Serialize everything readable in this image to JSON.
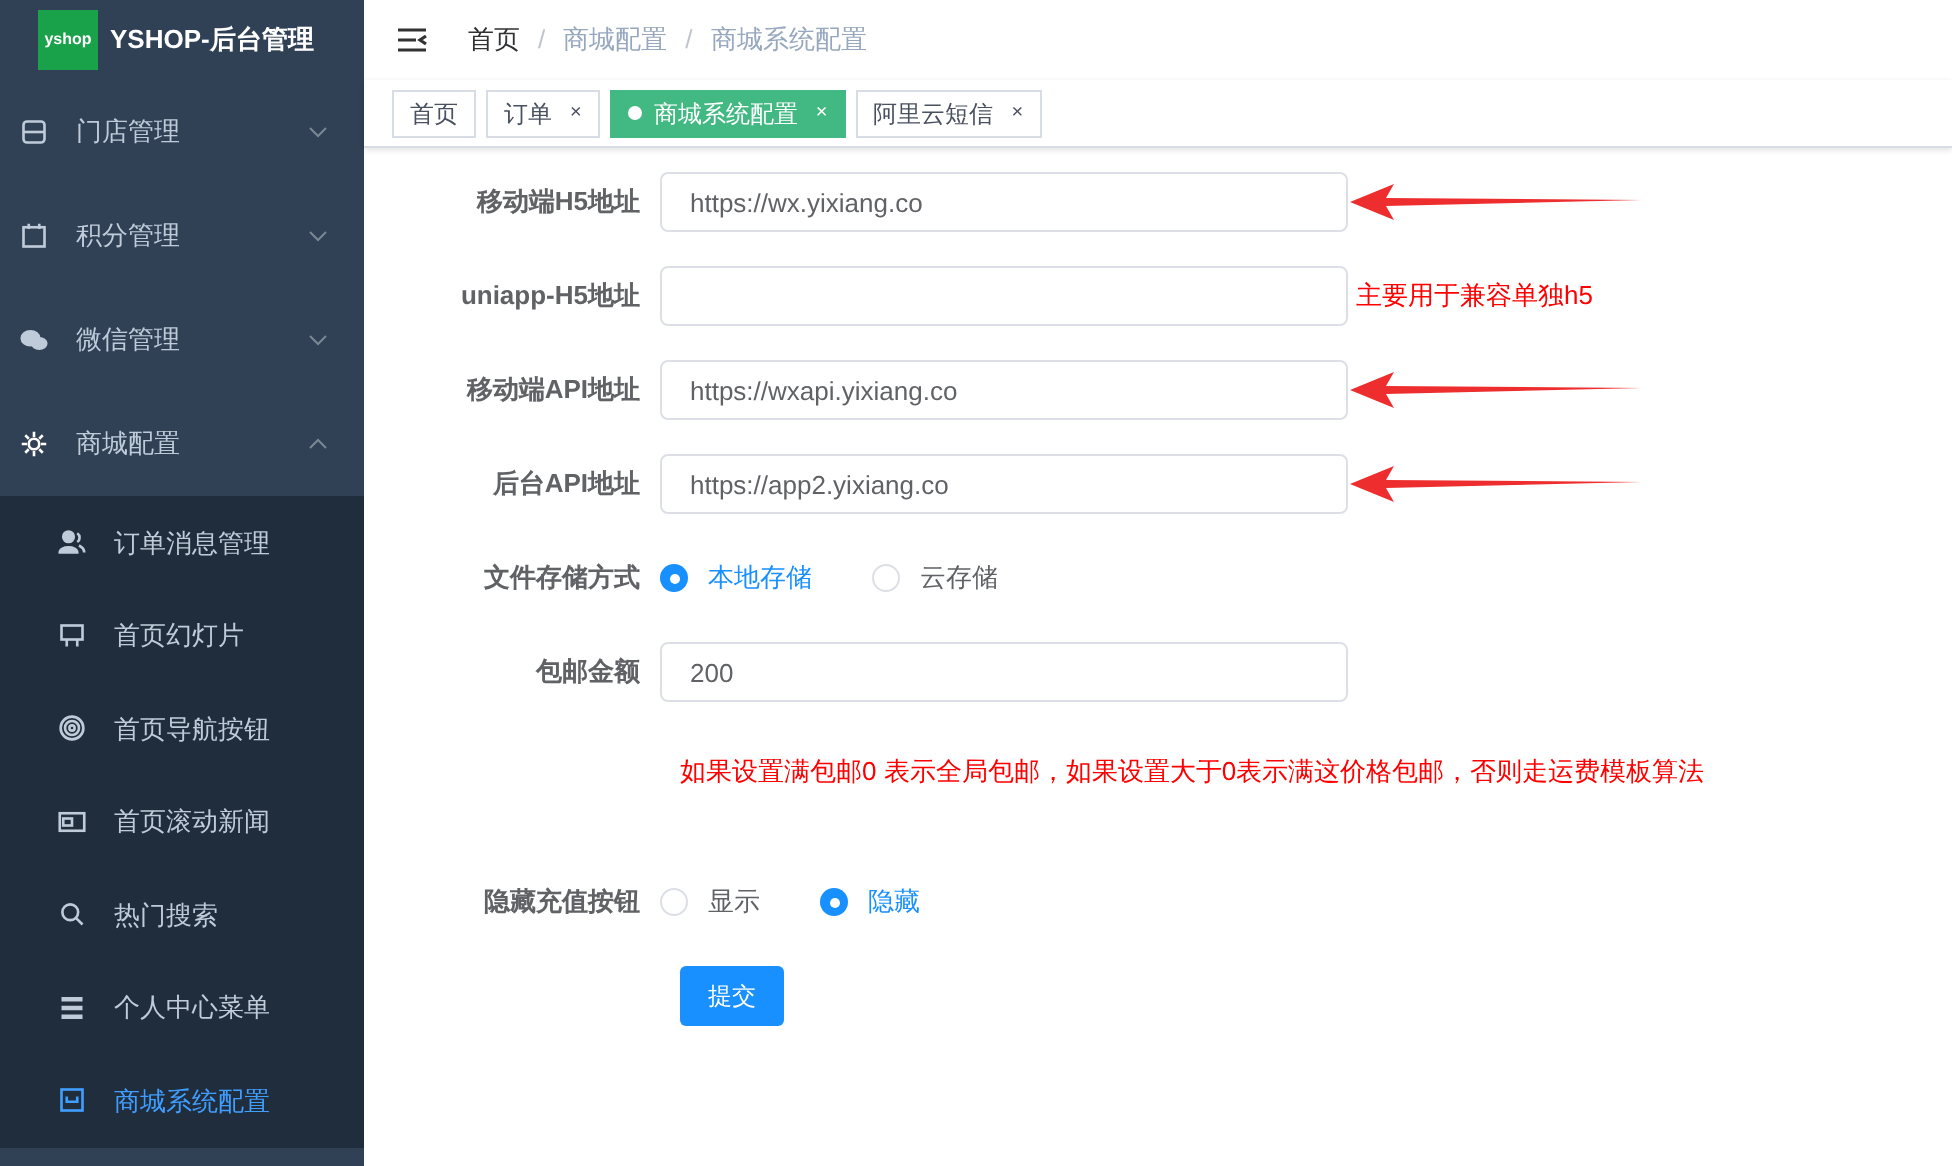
{
  "brand": {
    "title": "YSHOP-后台管理",
    "logo_text": "yshop"
  },
  "sidebar": {
    "items": [
      {
        "label": "门店管理",
        "expanded": false
      },
      {
        "label": "积分管理",
        "expanded": false
      },
      {
        "label": "微信管理",
        "expanded": false
      },
      {
        "label": "商城配置",
        "expanded": true,
        "children": [
          {
            "label": "订单消息管理",
            "selected": false
          },
          {
            "label": "首页幻灯片",
            "selected": false
          },
          {
            "label": "首页导航按钮",
            "selected": false
          },
          {
            "label": "首页滚动新闻",
            "selected": false
          },
          {
            "label": "热门搜索",
            "selected": false
          },
          {
            "label": "个人中心菜单",
            "selected": false
          },
          {
            "label": "商城系统配置",
            "selected": true
          }
        ]
      }
    ]
  },
  "breadcrumb": {
    "separator": "/",
    "items": [
      "首页",
      "商城配置",
      "商城系统配置"
    ]
  },
  "tabs": [
    {
      "label": "首页",
      "selected": false,
      "closable": false
    },
    {
      "label": "订单",
      "selected": false,
      "closable": true
    },
    {
      "label": "商城系统配置",
      "selected": true,
      "closable": true
    },
    {
      "label": "阿里云短信",
      "selected": false,
      "closable": true
    }
  ],
  "close_glyph": "×",
  "form": [
    {
      "kind": "text",
      "label": "移动端H5地址",
      "value": "https://wx.yixiang.co",
      "arrow": true
    },
    {
      "kind": "text",
      "label": "uniapp-H5地址",
      "note": "主要用于兼容单独h5",
      "arrow": false
    },
    {
      "kind": "text",
      "label": "移动端API地址",
      "value": "https://wxapi.yixiang.co",
      "arrow": true
    },
    {
      "kind": "text",
      "label": "后台API地址",
      "value": "https://app2.yixiang.co",
      "arrow": true
    },
    {
      "kind": "radio",
      "label": "文件存储方式",
      "options": [
        {
          "label": "本地存储",
          "selected": true
        },
        {
          "label": "云存储",
          "selected": false
        }
      ]
    },
    {
      "kind": "text",
      "label": "包邮金额",
      "value": "200",
      "arrow": false
    },
    {
      "kind": "hint",
      "text": "如果设置满包邮0 表示全局包邮，如果设置大于0表示满这价格包邮，否则走运费模板算法"
    },
    {
      "kind": "radio",
      "label": "隐藏充值按钮",
      "options": [
        {
          "label": "显示",
          "selected": false
        },
        {
          "label": "隐藏",
          "selected": true
        }
      ]
    }
  ],
  "submit": "提交"
}
